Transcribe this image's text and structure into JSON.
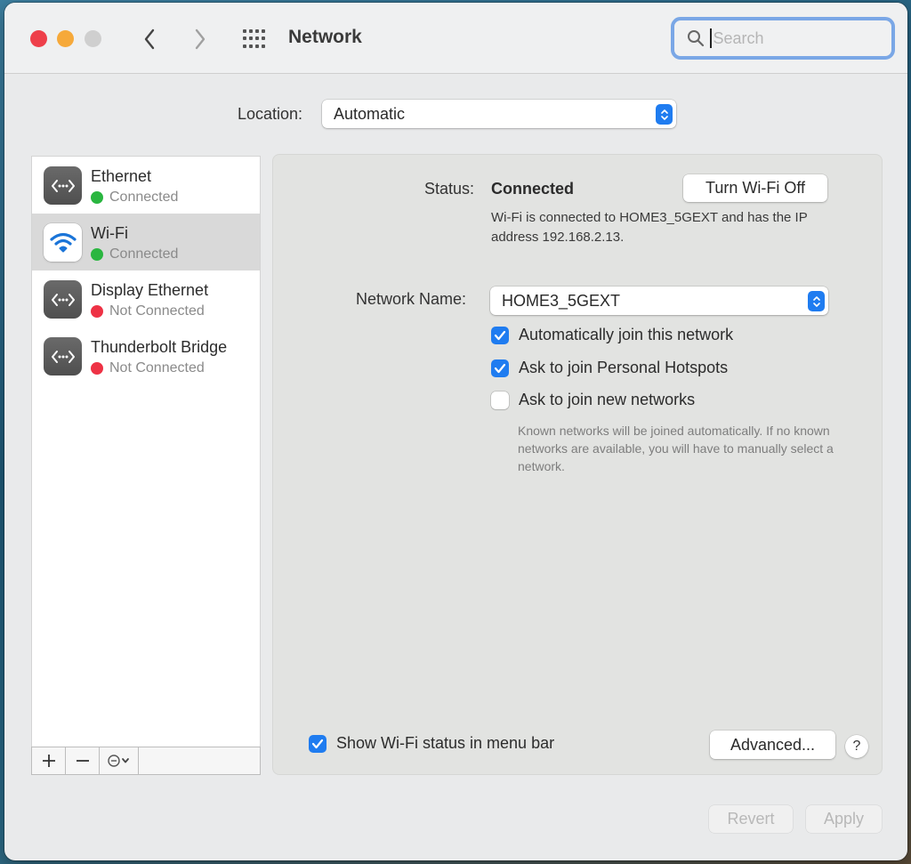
{
  "window": {
    "title": "Network",
    "search": {
      "placeholder": "Search",
      "value": ""
    }
  },
  "location": {
    "label": "Location:",
    "value": "Automatic"
  },
  "sidebar": {
    "services": [
      {
        "name": "Ethernet",
        "status": "Connected",
        "status_color": "#2ab640",
        "icon": "ethernet-icon",
        "selected": false
      },
      {
        "name": "Wi-Fi",
        "status": "Connected",
        "status_color": "#2ab640",
        "icon": "wifi-icon",
        "selected": true
      },
      {
        "name": "Display Ethernet",
        "status": "Not Connected",
        "status_color": "#ee3245",
        "icon": "ethernet-icon",
        "selected": false
      },
      {
        "name": "Thunderbolt Bridge",
        "status": "Not Connected",
        "status_color": "#ee3245",
        "icon": "ethernet-icon",
        "selected": false
      }
    ],
    "toolbar": {
      "add": "+",
      "remove": "−",
      "action": "⊖⌄"
    }
  },
  "detail": {
    "status_label": "Status:",
    "status_value": "Connected",
    "turn_off_button": "Turn Wi-Fi Off",
    "status_description": "Wi-Fi is connected to HOME3_5GEXT and has the IP address 192.168.2.13.",
    "network_name_label": "Network Name:",
    "network_name_value": "HOME3_5GEXT",
    "options": [
      {
        "label": "Automatically join this network",
        "checked": true
      },
      {
        "label": "Ask to join Personal Hotspots",
        "checked": true
      },
      {
        "label": "Ask to join new networks",
        "checked": false
      }
    ],
    "hint": "Known networks will be joined automatically. If no known networks are available, you will have to manually select a network.",
    "show_status": {
      "label": "Show Wi-Fi status in menu bar",
      "checked": true
    },
    "advanced_button": "Advanced...",
    "help_button": "?"
  },
  "footer": {
    "revert_button": "Revert",
    "apply_button": "Apply"
  },
  "colors": {
    "accent": "#1f7cf0",
    "connected": "#2ab640",
    "not_connected": "#ee3245"
  }
}
